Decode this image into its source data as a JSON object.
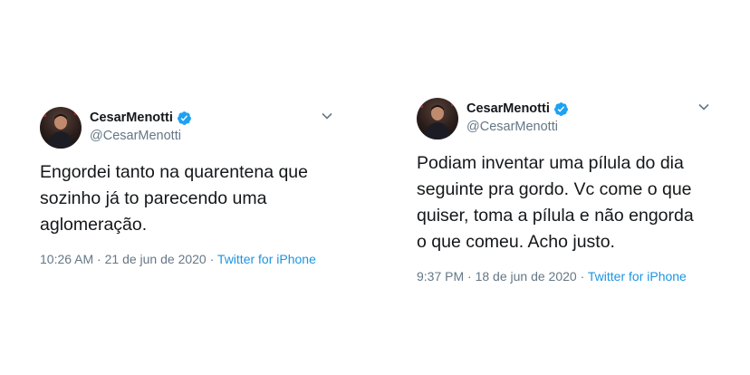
{
  "tweets": [
    {
      "display_name": "CesarMenotti",
      "handle": "@CesarMenotti",
      "text": "Engordei tanto na quarentena que\nsozinho já to parecendo uma\naglomeração.",
      "time": "10:26 AM",
      "date": "21 de jun de 2020",
      "separator": "·",
      "source": "Twitter for iPhone",
      "icons": {
        "verified": "verified-badge-icon",
        "caret": "chevron-down-icon"
      }
    },
    {
      "display_name": "CesarMenotti",
      "handle": "@CesarMenotti",
      "text": "Podiam inventar uma pílula do dia\nseguinte pra gordo. Vc come o que\nquiser, toma a pílula e não engorda\no que comeu. Acho justo.",
      "time": "9:37 PM",
      "date": "18 de jun de 2020",
      "separator": "·",
      "source": "Twitter for iPhone",
      "icons": {
        "verified": "verified-badge-icon",
        "caret": "chevron-down-icon"
      }
    }
  ],
  "colors": {
    "text_primary": "#14171a",
    "text_secondary": "#657786",
    "link": "#1b95e0",
    "verified": "#1da1f2"
  }
}
